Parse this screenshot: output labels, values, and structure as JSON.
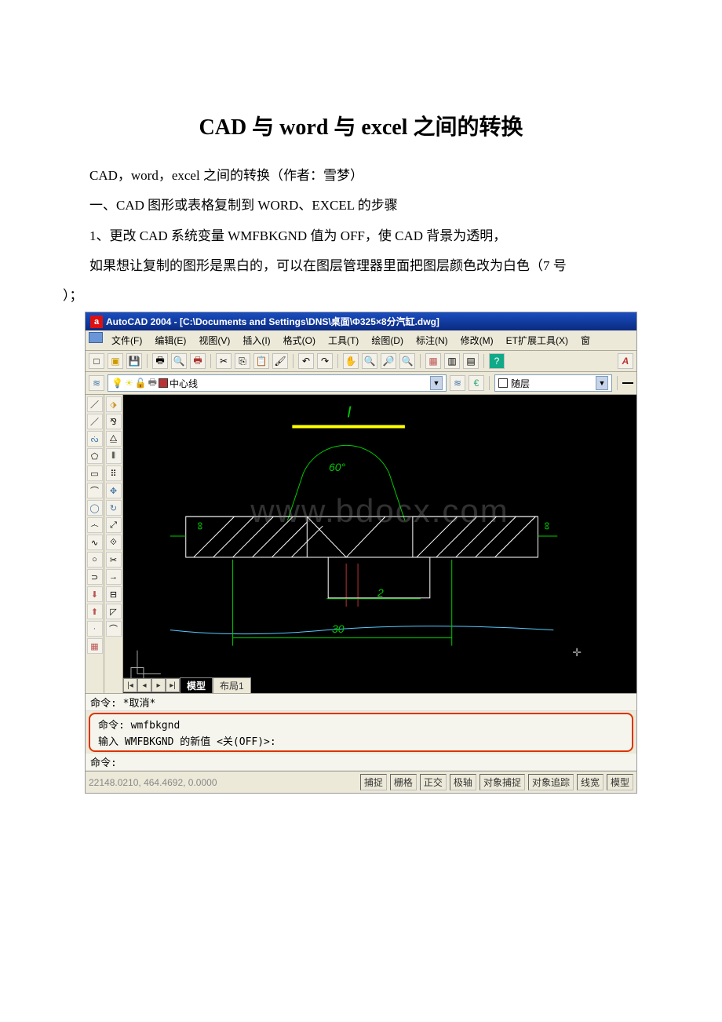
{
  "doc": {
    "title": "CAD 与 word 与 excel 之间的转换",
    "p1": "CAD，word，excel 之间的转换（作者：雪梦）",
    "p2": "一、CAD 图形或表格复制到 WORD、EXCEL 的步骤",
    "p3": "1、更改 CAD 系统变量 WMFBKGND 值为 OFF，使 CAD 背景为透明，",
    "p4": "如果想让复制的图形是黑白的，可以在图层管理器里面把图层颜色改为白色（7 号",
    "p5": "）；"
  },
  "cad": {
    "titlebar": "AutoCAD 2004 - [C:\\Documents and Settings\\DNS\\桌面\\Φ325×8分汽缸.dwg]",
    "menu": [
      "文件(F)",
      "编辑(E)",
      "视图(V)",
      "插入(I)",
      "格式(O)",
      "工具(T)",
      "绘图(D)",
      "标注(N)",
      "修改(M)",
      "ET扩展工具(X)",
      "窗"
    ],
    "layer_combo_text": "中心线",
    "color_combo_text": "随层",
    "tabs": {
      "active": "模型",
      "inactive": "布局1"
    },
    "cmd": {
      "l1": "命令:  *取消*",
      "l2": "命令:  wmfbkgnd",
      "l3": "输入 WMFBKGND 的新值 <关(OFF)>:",
      "l4": "命令:"
    },
    "status": {
      "coords": "22148.0210, 464.4692, 0.0000",
      "buttons": [
        "捕捉",
        "栅格",
        "正交",
        "极轴",
        "对象捕捉",
        "对象追踪",
        "线宽",
        "模型"
      ]
    },
    "drawing": {
      "angle": "60°",
      "dim_bottom": "30",
      "dim_mid": "2",
      "inf_left": "∞",
      "inf_right": "∞",
      "wm": "www.bdocx.com"
    }
  }
}
